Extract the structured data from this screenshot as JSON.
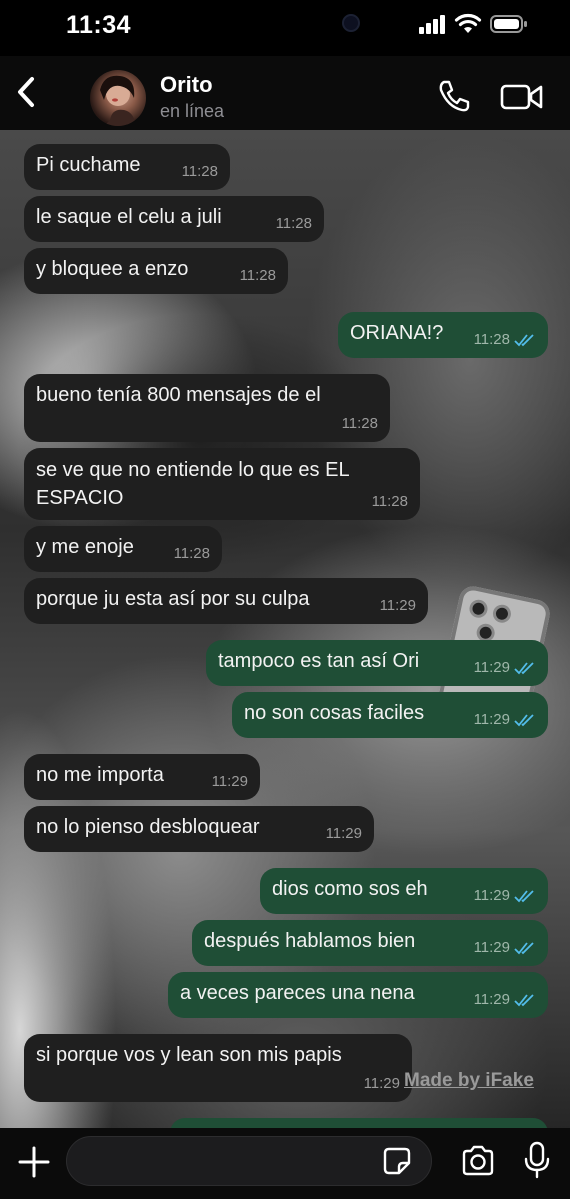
{
  "status_bar": {
    "time": "11:34"
  },
  "header": {
    "back_icon": "chevron-left-icon",
    "contact_name": "Orito",
    "contact_status": "en línea",
    "call_icon": "phone-icon",
    "video_icon": "video-camera-icon"
  },
  "messages": [
    {
      "dir": "in",
      "text": "Pi cuchame",
      "time": "11:28"
    },
    {
      "dir": "in",
      "text": "le saque el celu a juli",
      "time": "11:28"
    },
    {
      "dir": "in",
      "text": "y bloquee a enzo",
      "time": "11:28"
    },
    {
      "dir": "out",
      "text": "ORIANA!?",
      "time": "11:28"
    },
    {
      "dir": "in",
      "text": "bueno tenía 800 mensajes de el",
      "time": "11:28"
    },
    {
      "dir": "in",
      "text": "se ve que no entiende lo que es EL\nESPACIO",
      "time": "11:28"
    },
    {
      "dir": "in",
      "text": "y me enoje",
      "time": "11:28"
    },
    {
      "dir": "in",
      "text": "porque ju esta así por su culpa",
      "time": "11:29"
    },
    {
      "dir": "out",
      "text": "tampoco es tan así Ori",
      "time": "11:29"
    },
    {
      "dir": "out",
      "text": "no son cosas faciles",
      "time": "11:29"
    },
    {
      "dir": "in",
      "text": "no me importa",
      "time": "11:29"
    },
    {
      "dir": "in",
      "text": "no lo pienso desbloquear",
      "time": "11:29"
    },
    {
      "dir": "out",
      "text": "dios como sos eh",
      "time": "11:29"
    },
    {
      "dir": "out",
      "text": "después hablamos bien",
      "time": "11:29"
    },
    {
      "dir": "out",
      "text": "a veces pareces una nena",
      "time": "11:29"
    },
    {
      "dir": "in",
      "text": "si porque vos y lean son mis papis",
      "time": "11:29"
    }
  ],
  "watermark": "Made by iFake",
  "input_bar": {
    "plus_icon": "plus-icon",
    "message_value": "",
    "sticker_icon": "sticker-icon",
    "camera_icon": "camera-icon",
    "mic_icon": "microphone-icon"
  },
  "colors": {
    "incoming_bubble": "#1f1f1f",
    "outgoing_bubble": "#1f4e36",
    "read_ticks": "#53bdeb"
  }
}
